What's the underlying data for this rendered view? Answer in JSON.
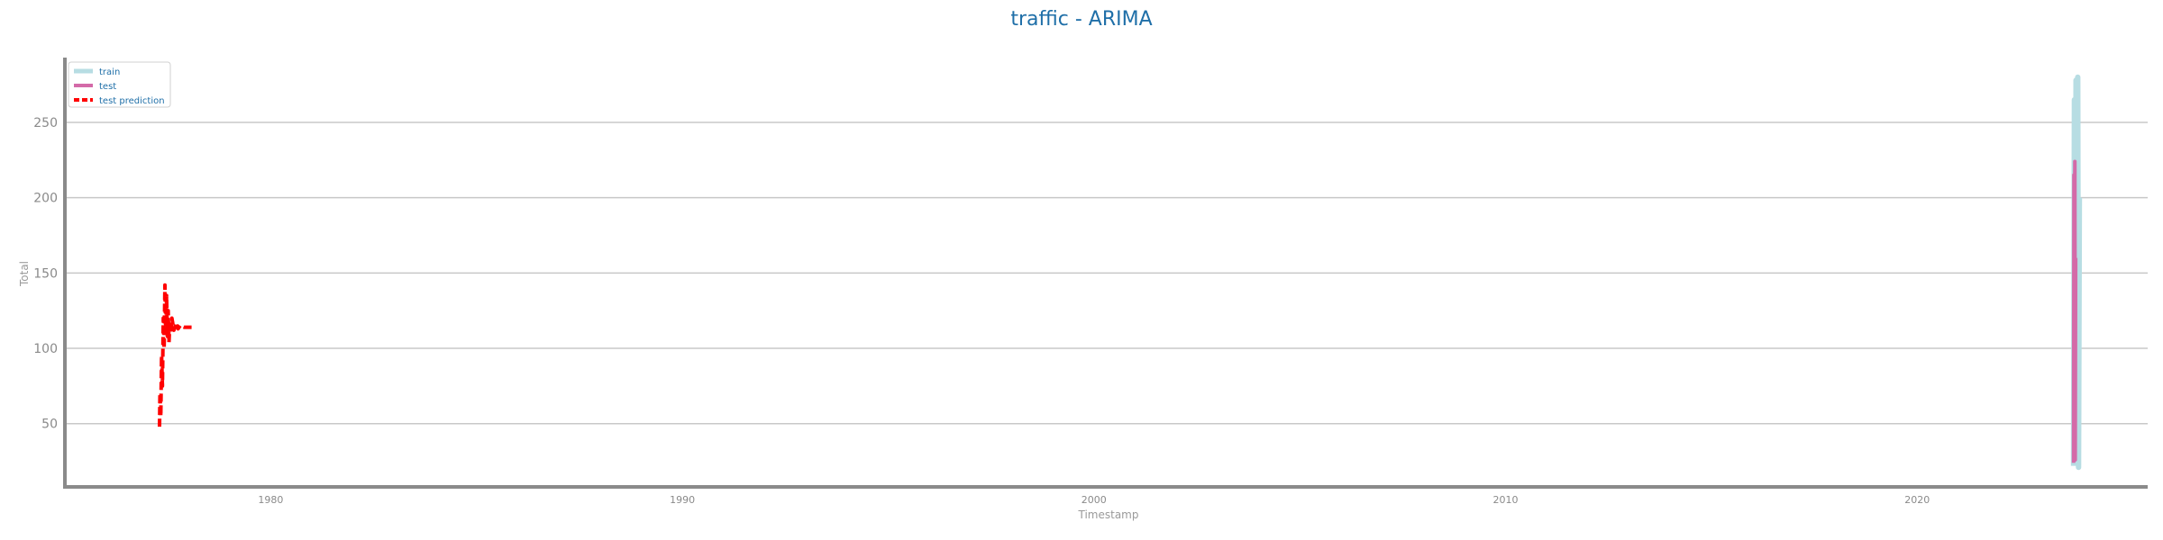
{
  "chart_data": {
    "type": "line",
    "title": "traffic - ARIMA",
    "xlabel": "Timestamp",
    "ylabel": "Total",
    "xlim": [
      1975.0,
      2025.6
    ],
    "ylim": [
      8,
      293
    ],
    "x_ticks": [
      1980,
      1990,
      2000,
      2010,
      2020
    ],
    "x_tick_labels": [
      "1980",
      "1990",
      "2000",
      "2010",
      "2020"
    ],
    "y_ticks": [
      50,
      100,
      150,
      200,
      250
    ],
    "y_tick_labels": [
      "50",
      "100",
      "150",
      "200",
      "250"
    ],
    "grid": "horizontal",
    "legend_position": "top-left",
    "series": [
      {
        "name": "train",
        "color": "#b7dde3",
        "style": "solid",
        "x": [
          2023.8,
          2023.82,
          2023.84,
          2023.86,
          2023.88,
          2023.9,
          2023.92,
          2023.94
        ],
        "y": [
          22,
          265,
          30,
          278,
          25,
          280,
          21,
          200
        ]
      },
      {
        "name": "test",
        "color": "#d46aa8",
        "style": "solid",
        "x": [
          2023.8,
          2023.81,
          2023.82,
          2023.83,
          2023.84,
          2023.85
        ],
        "y": [
          24,
          215,
          30,
          224,
          26,
          160
        ]
      },
      {
        "name": "test prediction",
        "color": "#ff0000",
        "style": "dashed",
        "x": [
          1977.3,
          1977.31,
          1977.33,
          1977.35,
          1977.37,
          1977.39,
          1977.41,
          1977.43,
          1977.45,
          1977.47,
          1977.49,
          1977.51,
          1977.53,
          1977.55,
          1977.57,
          1977.6,
          1977.65,
          1977.7,
          1977.75,
          1977.8,
          1977.9,
          1978.0,
          1978.1
        ],
        "y": [
          48,
          70,
          55,
          95,
          75,
          120,
          100,
          142,
          110,
          135,
          108,
          125,
          104,
          118,
          110,
          120,
          112,
          117,
          113,
          115,
          114,
          114,
          114
        ]
      }
    ]
  }
}
